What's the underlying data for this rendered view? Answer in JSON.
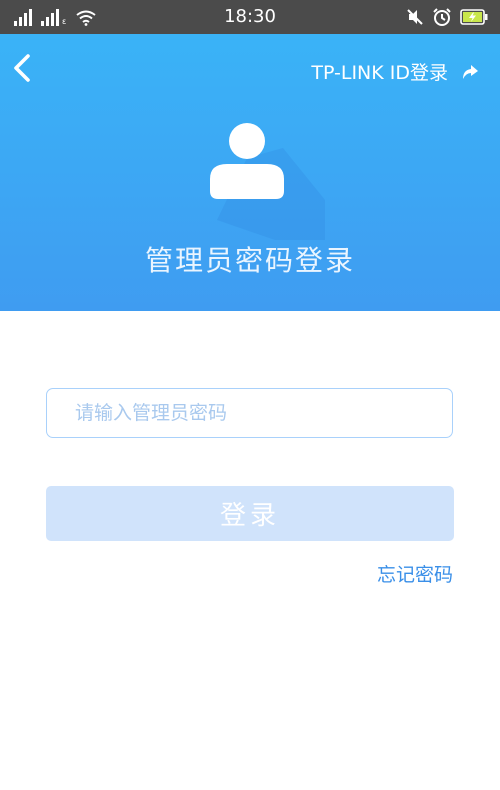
{
  "status_bar": {
    "time": "18:30",
    "sim1_tag": "",
    "sim2_tag": "ε",
    "icons": [
      "signal-icon",
      "signal-icon",
      "wifi-icon",
      "mute-icon",
      "alarm-icon",
      "battery-charging-icon"
    ]
  },
  "header": {
    "back_icon": "chevron-left-icon",
    "tplink_login_label": "TP-LINK ID登录",
    "tplink_icon": "share-arrow-icon",
    "avatar_icon": "user-icon",
    "title": "管理员密码登录",
    "colors": {
      "gradient_top": "#3ab3f7",
      "gradient_bottom": "#3f9cf1"
    }
  },
  "form": {
    "password_placeholder": "请输入管理员密码",
    "password_value": "",
    "login_label": "登录",
    "forgot_label": "忘记密码",
    "colors": {
      "button": "#d0e3fb",
      "link": "#3a8fe8",
      "input_border": "#a9d1fb"
    }
  }
}
